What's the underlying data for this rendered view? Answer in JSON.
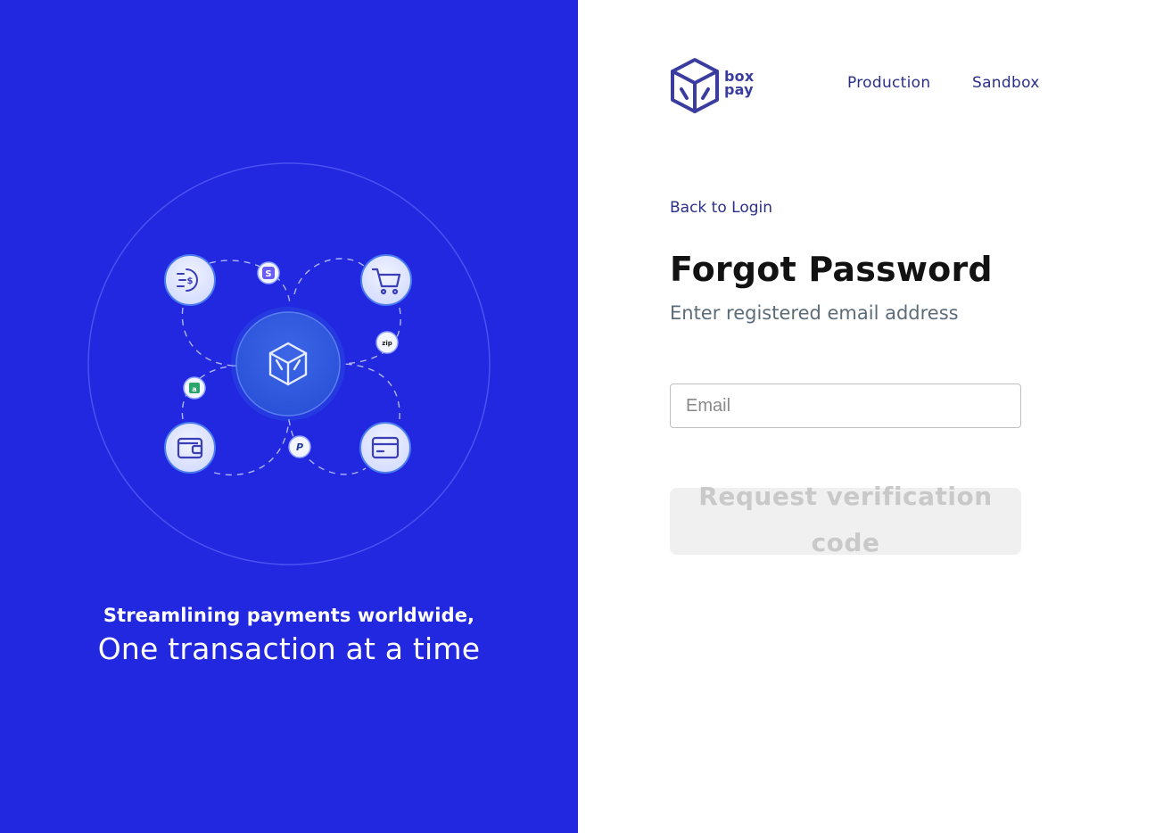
{
  "hero": {
    "tagline_line1": "Streamlining payments worldwide,",
    "tagline_line2": "One transaction at a time",
    "icons": [
      "cash-flow-icon",
      "cart-icon",
      "wallet-icon",
      "card-icon",
      "box-icon",
      "stripe-badge-icon",
      "zip-badge-icon",
      "green-badge-icon",
      "paypal-badge-icon"
    ],
    "badges": {
      "stripe": "S",
      "zip": "zip",
      "paypal": "P",
      "green": "a"
    }
  },
  "brand": {
    "name_line1": "box",
    "name_line2": "pay",
    "color": "#3b3c9f"
  },
  "nav": {
    "production_label": "Production",
    "sandbox_label": "Sandbox"
  },
  "form": {
    "back_label": "Back to Login",
    "title": "Forgot Password",
    "subtitle": "Enter registered email address",
    "email_placeholder": "Email",
    "email_value": "",
    "submit_label": "Request verification code",
    "submit_disabled": true
  },
  "colors": {
    "left_background": "#2227e0",
    "title": "#121212",
    "link": "#2c2f8a",
    "button_bg": "#f0f0f0",
    "button_text": "#c9c9c9"
  }
}
